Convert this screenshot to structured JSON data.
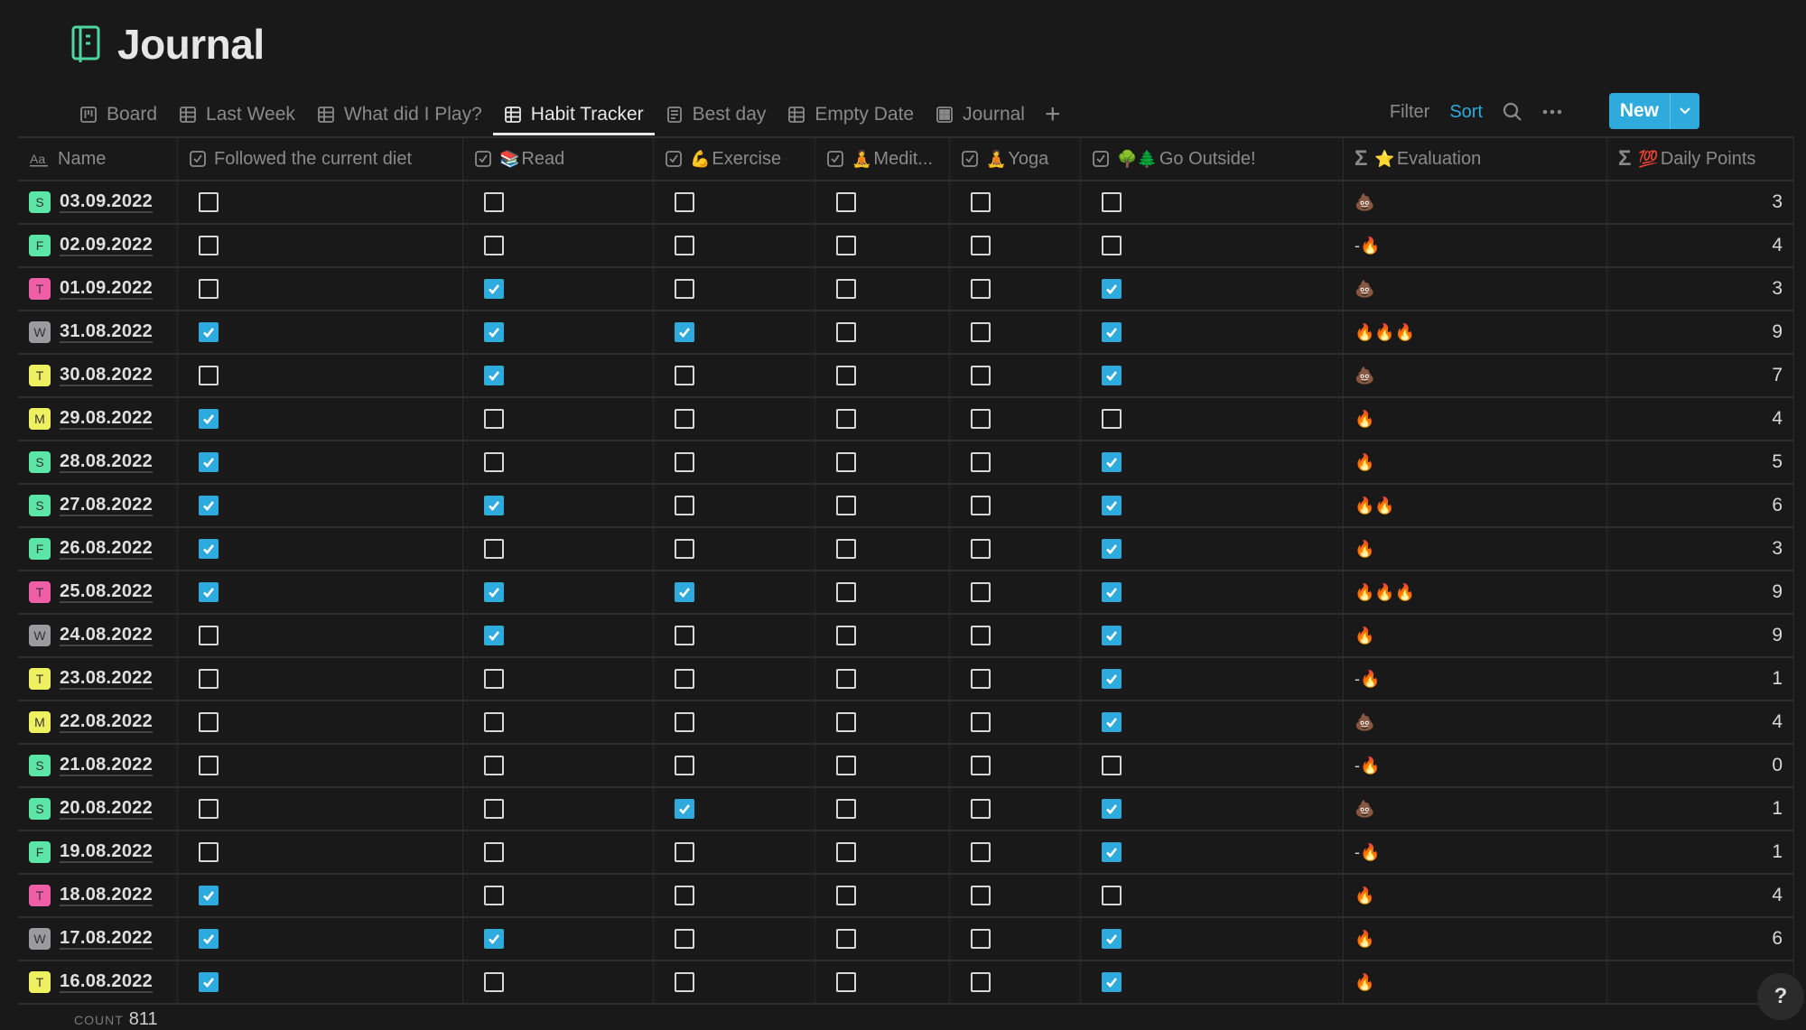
{
  "page": {
    "title": "Journal",
    "icon": "notebook-icon"
  },
  "colors": {
    "accent": "#2eaadc",
    "title_icon": "#4fd6a0",
    "background": "#191919"
  },
  "tabs": [
    {
      "label": "Board",
      "icon": "board-icon",
      "active": false
    },
    {
      "label": "Last Week",
      "icon": "table-icon",
      "active": false
    },
    {
      "label": "What did I Play?",
      "icon": "table-icon",
      "active": false
    },
    {
      "label": "Habit Tracker",
      "icon": "table-icon",
      "active": true
    },
    {
      "label": "Best day",
      "icon": "list-icon",
      "active": false
    },
    {
      "label": "Empty Date",
      "icon": "table-icon",
      "active": false
    },
    {
      "label": "Journal",
      "icon": "gallery-icon",
      "active": false
    }
  ],
  "toolbar": {
    "filter": "Filter",
    "sort": "Sort",
    "new": "New"
  },
  "columns": [
    {
      "label": "Name",
      "icon": "text-icon",
      "emoji": ""
    },
    {
      "label": "Followed the current diet",
      "icon": "checkbox-icon",
      "emoji": ""
    },
    {
      "label": "Read",
      "icon": "checkbox-icon",
      "emoji": "📚"
    },
    {
      "label": "Exercise",
      "icon": "checkbox-icon",
      "emoji": "💪"
    },
    {
      "label": "Medit...",
      "icon": "checkbox-icon",
      "emoji": "🧘"
    },
    {
      "label": "Yoga",
      "icon": "checkbox-icon",
      "emoji": "🧘"
    },
    {
      "label": "Go Outside!",
      "icon": "checkbox-icon",
      "emoji": "🌳🌲"
    },
    {
      "label": "Evaluation",
      "icon": "formula-icon",
      "emoji": "⭐"
    },
    {
      "label": "Daily Points",
      "icon": "formula-icon",
      "emoji": "💯"
    }
  ],
  "day_colors": {
    "S": "#5ce6a6",
    "F": "#5ce6a6",
    "T_pink": "#f05ea8",
    "W": "#9b9a9f",
    "T_yellow": "#eef062",
    "M": "#eef062"
  },
  "rows": [
    {
      "day": "S",
      "badge": "#5ce6a6",
      "date": "03.09.2022",
      "diet": false,
      "read": false,
      "exercise": false,
      "meditate": false,
      "yoga": false,
      "outside": false,
      "evaluation": "💩",
      "points": "3"
    },
    {
      "day": "F",
      "badge": "#5ce6a6",
      "date": "02.09.2022",
      "diet": false,
      "read": false,
      "exercise": false,
      "meditate": false,
      "yoga": false,
      "outside": false,
      "evaluation": "-🔥",
      "points": "4"
    },
    {
      "day": "T",
      "badge": "#f05ea8",
      "date": "01.09.2022",
      "diet": false,
      "read": true,
      "exercise": false,
      "meditate": false,
      "yoga": false,
      "outside": true,
      "evaluation": "💩",
      "points": "3"
    },
    {
      "day": "W",
      "badge": "#9b9a9f",
      "date": "31.08.2022",
      "diet": true,
      "read": true,
      "exercise": true,
      "meditate": false,
      "yoga": false,
      "outside": true,
      "evaluation": "🔥🔥🔥",
      "points": "9"
    },
    {
      "day": "T",
      "badge": "#eef062",
      "date": "30.08.2022",
      "diet": false,
      "read": true,
      "exercise": false,
      "meditate": false,
      "yoga": false,
      "outside": true,
      "evaluation": "💩",
      "points": "7"
    },
    {
      "day": "M",
      "badge": "#eef062",
      "date": "29.08.2022",
      "diet": true,
      "read": false,
      "exercise": false,
      "meditate": false,
      "yoga": false,
      "outside": false,
      "evaluation": "🔥",
      "points": "4"
    },
    {
      "day": "S",
      "badge": "#5ce6a6",
      "date": "28.08.2022",
      "diet": true,
      "read": false,
      "exercise": false,
      "meditate": false,
      "yoga": false,
      "outside": true,
      "evaluation": "🔥",
      "points": "5"
    },
    {
      "day": "S",
      "badge": "#5ce6a6",
      "date": "27.08.2022",
      "diet": true,
      "read": true,
      "exercise": false,
      "meditate": false,
      "yoga": false,
      "outside": true,
      "evaluation": "🔥🔥",
      "points": "6"
    },
    {
      "day": "F",
      "badge": "#5ce6a6",
      "date": "26.08.2022",
      "diet": true,
      "read": false,
      "exercise": false,
      "meditate": false,
      "yoga": false,
      "outside": true,
      "evaluation": "🔥",
      "points": "3"
    },
    {
      "day": "T",
      "badge": "#f05ea8",
      "date": "25.08.2022",
      "diet": true,
      "read": true,
      "exercise": true,
      "meditate": false,
      "yoga": false,
      "outside": true,
      "evaluation": "🔥🔥🔥",
      "points": "9"
    },
    {
      "day": "W",
      "badge": "#9b9a9f",
      "date": "24.08.2022",
      "diet": false,
      "read": true,
      "exercise": false,
      "meditate": false,
      "yoga": false,
      "outside": true,
      "evaluation": "🔥",
      "points": "9"
    },
    {
      "day": "T",
      "badge": "#eef062",
      "date": "23.08.2022",
      "diet": false,
      "read": false,
      "exercise": false,
      "meditate": false,
      "yoga": false,
      "outside": true,
      "evaluation": "-🔥",
      "points": "1"
    },
    {
      "day": "M",
      "badge": "#eef062",
      "date": "22.08.2022",
      "diet": false,
      "read": false,
      "exercise": false,
      "meditate": false,
      "yoga": false,
      "outside": true,
      "evaluation": "💩",
      "points": "4"
    },
    {
      "day": "S",
      "badge": "#5ce6a6",
      "date": "21.08.2022",
      "diet": false,
      "read": false,
      "exercise": false,
      "meditate": false,
      "yoga": false,
      "outside": false,
      "evaluation": "-🔥",
      "points": "0"
    },
    {
      "day": "S",
      "badge": "#5ce6a6",
      "date": "20.08.2022",
      "diet": false,
      "read": false,
      "exercise": true,
      "meditate": false,
      "yoga": false,
      "outside": true,
      "evaluation": "💩",
      "points": "1"
    },
    {
      "day": "F",
      "badge": "#5ce6a6",
      "date": "19.08.2022",
      "diet": false,
      "read": false,
      "exercise": false,
      "meditate": false,
      "yoga": false,
      "outside": true,
      "evaluation": "-🔥",
      "points": "1"
    },
    {
      "day": "T",
      "badge": "#f05ea8",
      "date": "18.08.2022",
      "diet": true,
      "read": false,
      "exercise": false,
      "meditate": false,
      "yoga": false,
      "outside": false,
      "evaluation": "🔥",
      "points": "4"
    },
    {
      "day": "W",
      "badge": "#9b9a9f",
      "date": "17.08.2022",
      "diet": true,
      "read": true,
      "exercise": false,
      "meditate": false,
      "yoga": false,
      "outside": true,
      "evaluation": "🔥",
      "points": "6"
    },
    {
      "day": "T",
      "badge": "#eef062",
      "date": "16.08.2022",
      "diet": true,
      "read": false,
      "exercise": false,
      "meditate": false,
      "yoga": false,
      "outside": true,
      "evaluation": "🔥",
      "points": ""
    }
  ],
  "footer": {
    "count_label": "COUNT",
    "count_value": "811"
  },
  "help": "?"
}
